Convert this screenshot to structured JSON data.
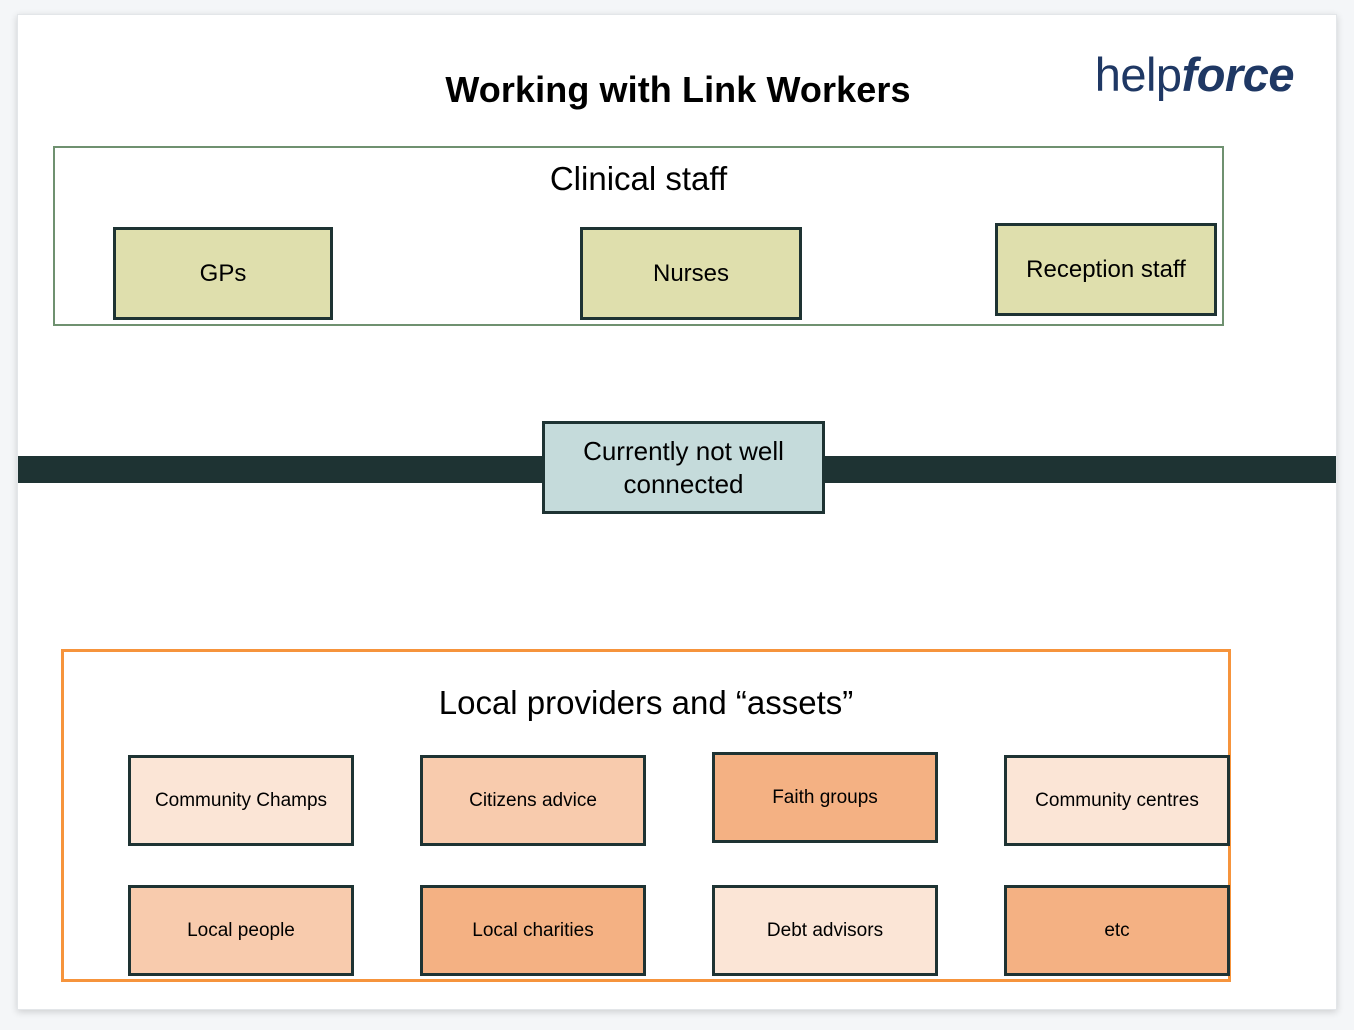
{
  "slide": {
    "title": "Working with Link Workers",
    "brand": {
      "part1": "help",
      "part2": "force",
      "color": "#1f3864"
    }
  },
  "clinical_section": {
    "heading": "Clinical staff",
    "border_color": "#6f9170",
    "box_fill": "#dfdfad",
    "box_border": "#1e3333",
    "boxes": [
      {
        "label": "GPs"
      },
      {
        "label": "Nurses"
      },
      {
        "label": "Reception staff"
      }
    ]
  },
  "gap": {
    "label": "Currently not well connected",
    "bar_color": "#1e3333",
    "box_fill": "#c5dbdb",
    "box_border": "#1e3333"
  },
  "providers_section": {
    "heading": "Local providers and “assets”",
    "border_color": "#f6943c",
    "box_border": "#1e3333",
    "boxes": [
      {
        "label": "Community Champs",
        "fill": "#fbe5d6"
      },
      {
        "label": "Citizens advice",
        "fill": "#f8cbad"
      },
      {
        "label": "Faith groups",
        "fill": "#f4b183"
      },
      {
        "label": "Community centres",
        "fill": "#fbe5d6"
      },
      {
        "label": "Local people",
        "fill": "#f8cbad"
      },
      {
        "label": "Local charities",
        "fill": "#f4b183"
      },
      {
        "label": "Debt advisors",
        "fill": "#fbe5d6"
      },
      {
        "label": "etc",
        "fill": "#f4b183"
      }
    ]
  }
}
